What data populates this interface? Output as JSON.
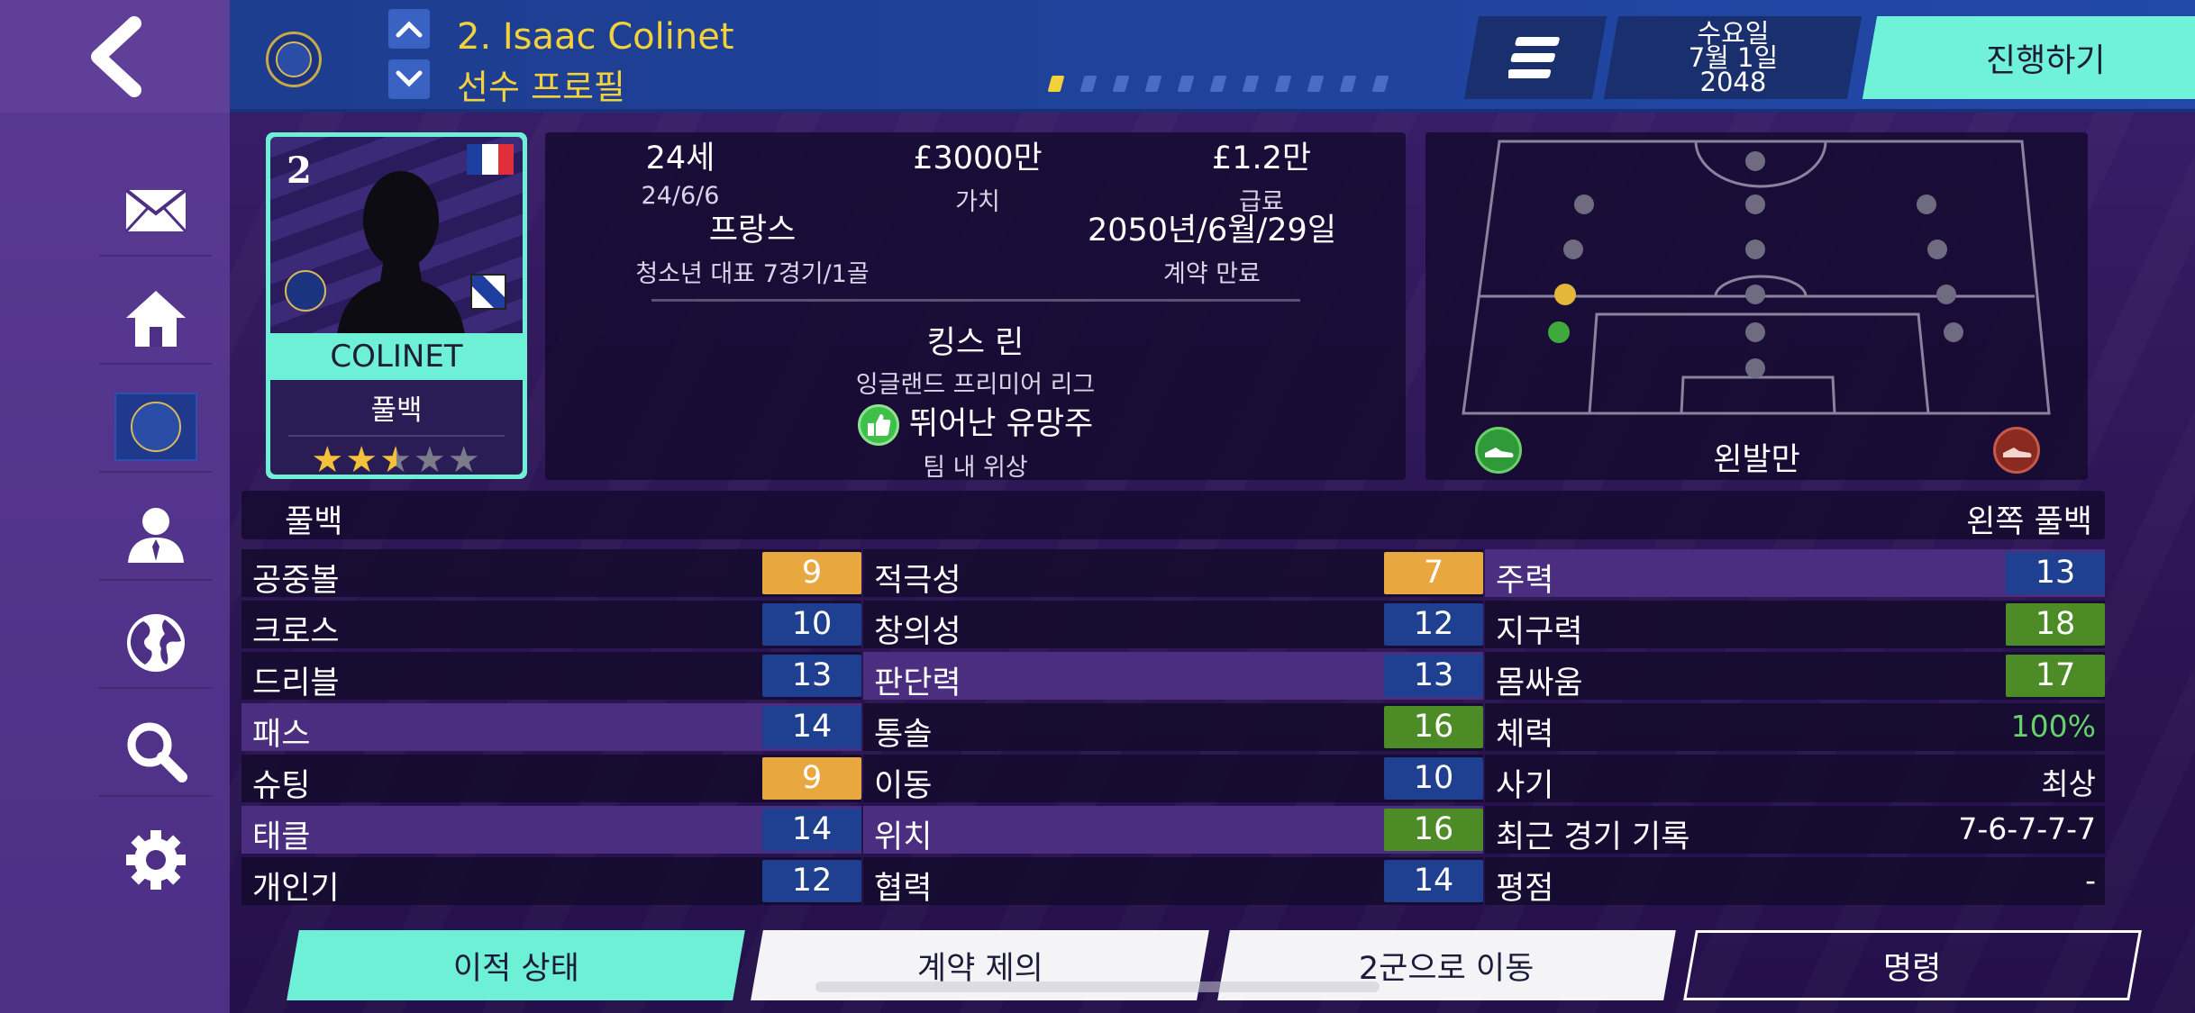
{
  "header": {
    "player_title": "2. Isaac Colinet",
    "page_subtitle": "선수 프로필",
    "pages_total": 11,
    "page_active": 0,
    "date": {
      "weekday": "수요일",
      "day": "7월 1일",
      "year": "2048"
    },
    "advance_label": "진행하기"
  },
  "sidebar": {
    "items": [
      {
        "icon": "back-arrow-icon"
      },
      {
        "icon": "mail-icon"
      },
      {
        "icon": "home-icon"
      },
      {
        "icon": "club-crest-icon"
      },
      {
        "icon": "person-icon"
      },
      {
        "icon": "globe-icon"
      },
      {
        "icon": "search-icon"
      },
      {
        "icon": "gear-icon"
      }
    ]
  },
  "card": {
    "number": "2",
    "name": "COLINET",
    "position": "풀백",
    "stars": 2.5,
    "stars_max": 5,
    "stars_text": {
      "on": "★★",
      "half": "★",
      "off": "★★"
    }
  },
  "info": {
    "age": "24세",
    "dob": "24/6/6",
    "value": "£3000만",
    "value_label": "가치",
    "wage": "£1.2만",
    "wage_label": "급료",
    "nation": "프랑스",
    "caps": "청소년 대표 7경기/1골",
    "contract": "2050년/6월/29일",
    "contract_label": "계약 만료",
    "club": "킹스 린",
    "league": "잉글랜드 프리미어 리그",
    "status": "뛰어난 유망주",
    "status_label": "팀 내 위상"
  },
  "pitch": {
    "foot": "왼발만"
  },
  "positions": {
    "main": "풀백",
    "detail": "왼쪽 풀백"
  },
  "attributes": {
    "col1": [
      {
        "name": "공중볼",
        "value": "9",
        "color": "orange"
      },
      {
        "name": "크로스",
        "value": "10",
        "color": "blue"
      },
      {
        "name": "드리블",
        "value": "13",
        "color": "blue"
      },
      {
        "name": "패스",
        "value": "14",
        "color": "blue",
        "highlight": true
      },
      {
        "name": "슈팅",
        "value": "9",
        "color": "orange"
      },
      {
        "name": "태클",
        "value": "14",
        "color": "blue",
        "highlight": true
      },
      {
        "name": "개인기",
        "value": "12",
        "color": "blue"
      }
    ],
    "col2": [
      {
        "name": "적극성",
        "value": "7",
        "color": "orange"
      },
      {
        "name": "창의성",
        "value": "12",
        "color": "blue"
      },
      {
        "name": "판단력",
        "value": "13",
        "color": "blue",
        "highlight": true
      },
      {
        "name": "통솔",
        "value": "16",
        "color": "green"
      },
      {
        "name": "이동",
        "value": "10",
        "color": "blue"
      },
      {
        "name": "위치",
        "value": "16",
        "color": "green",
        "highlight": true
      },
      {
        "name": "협력",
        "value": "14",
        "color": "blue"
      }
    ],
    "col3": [
      {
        "name": "주력",
        "value": "13",
        "color": "blue",
        "highlight": true
      },
      {
        "name": "지구력",
        "value": "18",
        "color": "green"
      },
      {
        "name": "몸싸움",
        "value": "17",
        "color": "green"
      },
      {
        "name": "체력",
        "text": "100%",
        "text_color": "#63d36a"
      },
      {
        "name": "사기",
        "text": "최상"
      },
      {
        "name": "최근 경기 기록",
        "text": "7-6-7-7-7"
      },
      {
        "name": "평점",
        "text": "-"
      }
    ]
  },
  "actions": {
    "transfer_status": "이적 상태",
    "offer_contract": "계약 제의",
    "move_reserve": "2군으로 이동",
    "orders": "명령"
  },
  "colors": {
    "accent_teal": "#6ef0d6",
    "title_yellow": "#f2d23c",
    "attr_blue": "#1f3f91",
    "attr_orange": "#e9a740",
    "attr_green": "#4c8b26"
  }
}
